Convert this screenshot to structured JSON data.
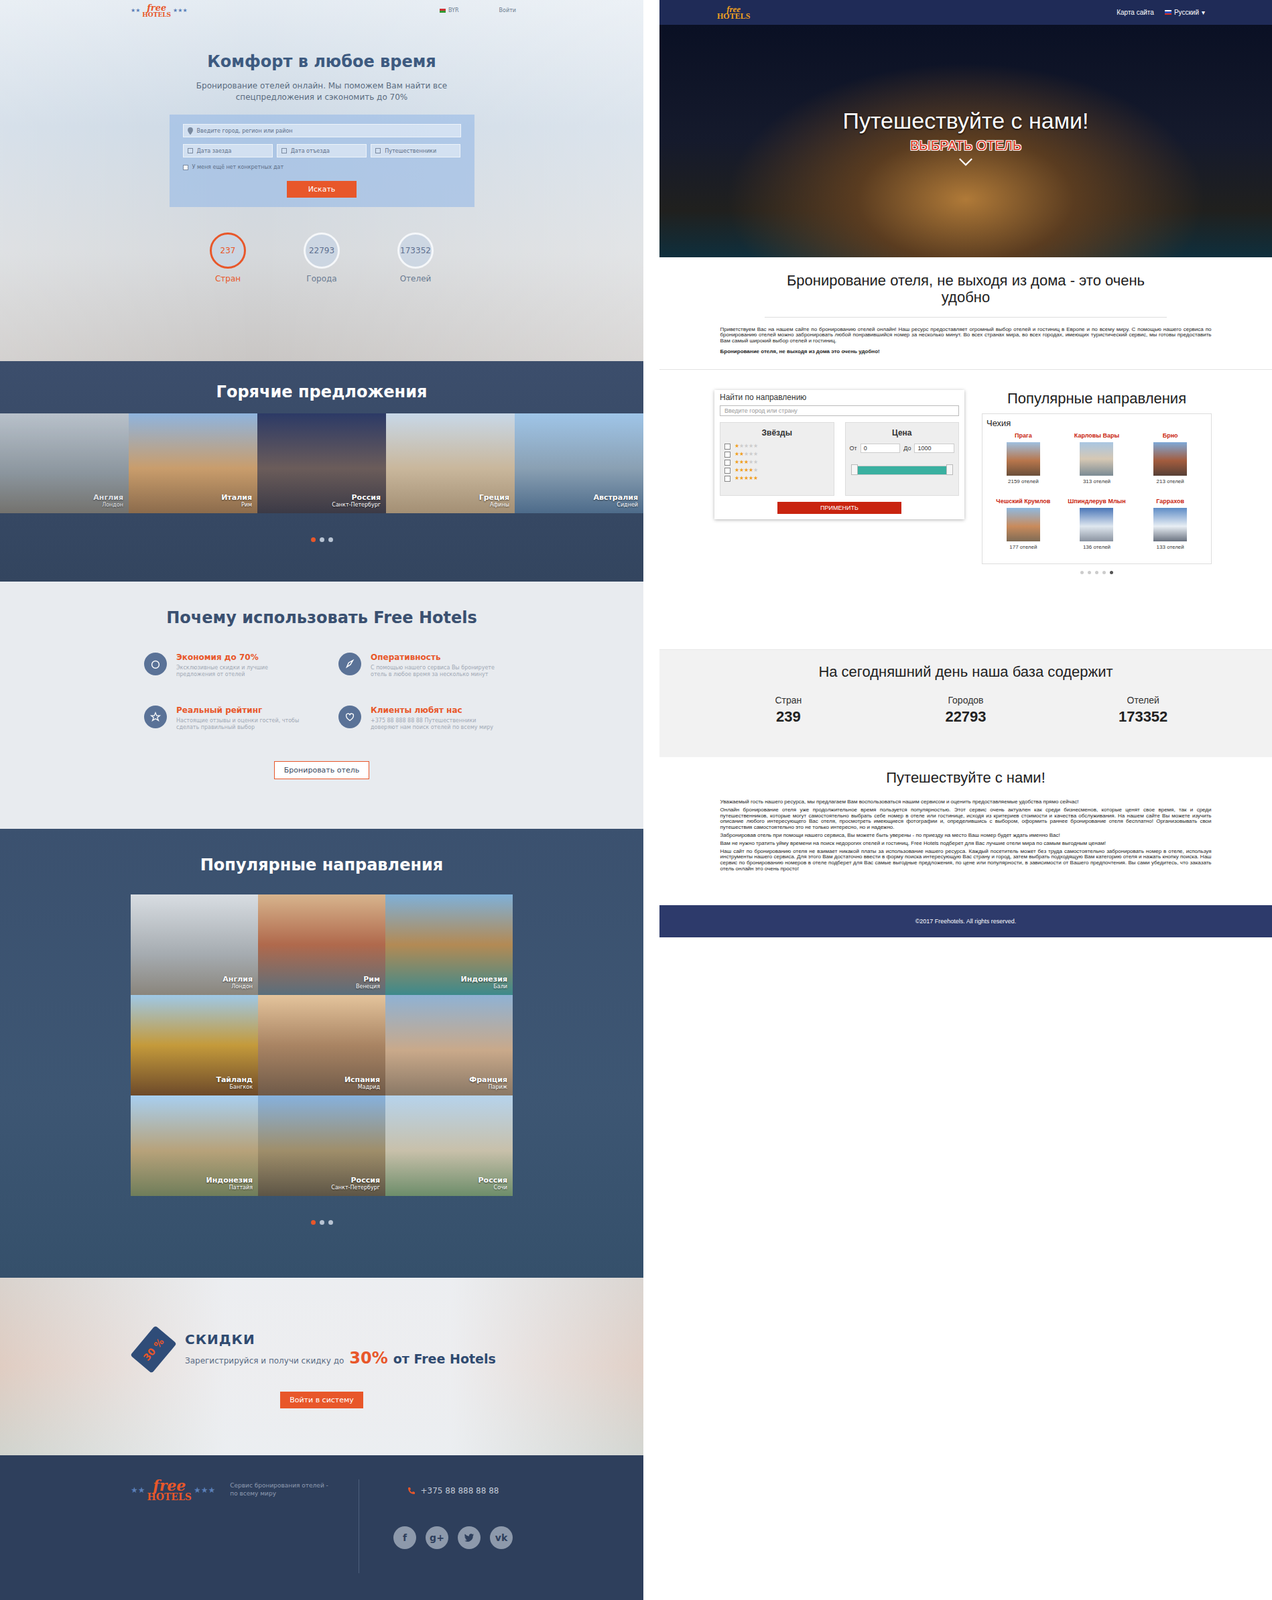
{
  "left": {
    "logo": {
      "top": "free",
      "bottom": "HOTELS"
    },
    "topbar": {
      "currency": "BYR",
      "login": "Войти"
    },
    "hero": {
      "title": "Комфорт в любое время",
      "subtitle": "Бронирование отелей онлайн. Мы поможем Вам найти все спецпредложения и сэкономить до 70%",
      "search_placeholder": "Введите город, регион или район",
      "fields": [
        "Дата заезда",
        "Дата отъезда",
        "Путешественники"
      ],
      "checkbox": {
        "label": "У меня ещё нет конкретных дат",
        "checked": false
      },
      "button": "Искать",
      "stats": [
        {
          "value": "237",
          "label": "Стран",
          "selected": true
        },
        {
          "value": "22793",
          "label": "Города",
          "selected": false
        },
        {
          "value": "173352",
          "label": "Отелей",
          "selected": false
        }
      ]
    },
    "hot": {
      "title": "Горячие предложения",
      "items": [
        {
          "country": "Англия",
          "city": "Лондон"
        },
        {
          "country": "Италия",
          "city": "Рим"
        },
        {
          "country": "Россия",
          "city": "Санкт-Петербург"
        },
        {
          "country": "Греция",
          "city": "Афины"
        },
        {
          "country": "Австралия",
          "city": "Сидней"
        }
      ],
      "dots": [
        {
          "selected": true
        },
        {
          "selected": false
        },
        {
          "selected": false
        }
      ]
    },
    "why": {
      "title": "Почему использовать Free Hotels",
      "features": [
        {
          "title": "Экономия до 70%",
          "text": "Эксклюзивные скидки и лучшие предложения от отелей"
        },
        {
          "title": "Оперативность",
          "text": "С помощью нашего сервиса Вы бронируете отель в любое время за несколько минут"
        },
        {
          "title": "Реальный рейтинг",
          "text": "Настоящие отзывы и оценки гостей, чтобы сделать правильный выбор"
        },
        {
          "title": "Клиенты любят нас",
          "text": "+375 88 888 88 88 Путешественники доверяют нам поиск отелей по всему миру"
        }
      ],
      "button": "Бронировать отель"
    },
    "popular": {
      "title": "Популярные направления",
      "items": [
        {
          "country": "Англия",
          "city": "Лондон"
        },
        {
          "country": "Рим",
          "city": "Венеция"
        },
        {
          "country": "Индонезия",
          "city": "Бали"
        },
        {
          "country": "Тайланд",
          "city": "Бангкок"
        },
        {
          "country": "Испания",
          "city": "Мадрид"
        },
        {
          "country": "Франция",
          "city": "Париж"
        },
        {
          "country": "Индонезия",
          "city": "Паттайя"
        },
        {
          "country": "Россия",
          "city": "Санкт-Петербург"
        },
        {
          "country": "Россия",
          "city": "Сочи"
        }
      ],
      "dots": [
        {
          "selected": true
        },
        {
          "selected": false
        },
        {
          "selected": false
        }
      ]
    },
    "discount": {
      "tag": "30 %",
      "title": "СКИДКИ",
      "text": "Зарегистрируйся и получи скидку до",
      "percent": "30%",
      "from": "от Free Hotels",
      "button": "Войти в систему"
    },
    "footer": {
      "text": "Сервис бронирования отелей - по всему миру",
      "phone": "+375 88 888 88 88",
      "social": [
        {
          "kind": "glyph",
          "glyph": "f"
        },
        {
          "kind": "glyph",
          "glyph": "g+"
        },
        {
          "kind": "bird",
          "glyph": ""
        },
        {
          "kind": "glyph",
          "glyph": "vk"
        }
      ]
    }
  },
  "right": {
    "logo": {
      "top": "free",
      "bottom": "HOTELS"
    },
    "header": {
      "sitemap": "Карта сайта",
      "language": "Русский",
      "caret": "▾"
    },
    "hero": {
      "title": "Путешествуйте с нами!",
      "button": "ВЫБРАТЬ ОТЕЛЬ"
    },
    "intro": {
      "title": "Бронирование отеля, не выходя из дома - это очень удобно",
      "text": "Приветствуем Вас на нашем сайте по бронированию отелей онлайн! Наш ресурс предоставляет огромный выбор отелей и гостиниц в Европе и по всему миру. С помощью нашего сервиса по бронированию отелей можно забронировать любой понравившийся номер за несколько минут. Во всех странах мира, во всех городах, имеющих туристический сервис, мы готовы предоставить Вам самый широкий выбор отелей и гостиниц.",
      "bold": "Бронирование отеля, не выходя из дома это очень удобно!"
    },
    "filter": {
      "title": "Найти по направлению",
      "placeholder": "Введите город или страну",
      "stars_title": "Звёзды",
      "star_rows": [
        {
          "stars": 1,
          "checked": false
        },
        {
          "stars": 2,
          "checked": false
        },
        {
          "stars": 3,
          "checked": false
        },
        {
          "stars": 4,
          "checked": false
        },
        {
          "stars": 5,
          "checked": false
        }
      ],
      "price_title": "Цена",
      "from_label": "От",
      "from_value": "0",
      "to_label": "До",
      "to_value": "1000",
      "low_level": 0,
      "high_level": 1,
      "button": "ПРИМЕНИТЬ"
    },
    "popular": {
      "title": "Популярные направления",
      "country": "Чехия",
      "cities": [
        {
          "name": "Прага",
          "count": "2159 отелей"
        },
        {
          "name": "Карловы Вары",
          "count": "313 отелей"
        },
        {
          "name": "Брно",
          "count": "213 отелей"
        },
        {
          "name": "Чешский Крумлов",
          "count": "177 отелей"
        },
        {
          "name": "Шпиндлерув Млын",
          "count": "136 отелей"
        },
        {
          "name": "Гаррахов",
          "count": "133 отелей"
        }
      ],
      "dots": [
        {
          "selected": false
        },
        {
          "selected": false
        },
        {
          "selected": false
        },
        {
          "selected": false
        },
        {
          "selected": true
        }
      ]
    },
    "stats": {
      "title": "На сегодняшний день наша база содержит",
      "items": [
        {
          "label": "Стран",
          "value": "239"
        },
        {
          "label": "Городов",
          "value": "22793"
        },
        {
          "label": "Отелей",
          "value": "173352"
        }
      ]
    },
    "travel": {
      "title": "Путешествуйте с нами!",
      "paragraphs": [
        "Уважаемый гость нашего ресурса, мы предлагаем Вам воспользоваться нашим сервисом и оценить предоставляемые удобства прямо сейчас!",
        "Онлайн бронирование отеля уже продолжительное время пользуется популярностью. Этот сервис очень актуален как среди бизнесменов, которые ценят свое время, так и среди путешественников, которые могут самостоятельно выбрать себе номер в отеле или гостинице, исходя из критериев стоимости и качества обслуживания. На нашем сайте Вы можете изучить описание любого интересующего Вас отеля, просмотреть имеющиеся фотографии и, определившись с выбором, оформить раннее бронирование отеля бесплатно! Организовывать свои путешествия самостоятельно это не только интересно, но и надежно.",
        "Забронировав отель при помощи нашего сервиса, Вы можете быть уверены - по приезду на место Ваш номер будет ждать именно Вас!",
        "Вам не нужно тратить уйму времени на поиск недорогих отелей и гостиниц. Free Hotels подберет для Вас лучшие отели мира по самым выгодным ценам!",
        "Наш сайт по бронированию отеля не взимает никакой платы за использование нашего ресурса. Каждый посетитель может без труда самостоятельно забронировать номер в отеле, используя инструменты нашего сервиса. Для этого Вам достаточно ввести в форму поиска интересующую Вас страну и город, затем выбрать подходящую Вам категорию отеля и нажать кнопку поиска. Наш сервис по бронированию номеров в отеле подберет для Вас самые выгодные предложения, по цене или популярности, в зависимости от Вашего предпочтения. Вы сами убедитесь, что заказать отель онлайн это очень просто!"
      ]
    },
    "footer": {
      "text": "©2017 Freehotels. All rights reserved."
    }
  }
}
